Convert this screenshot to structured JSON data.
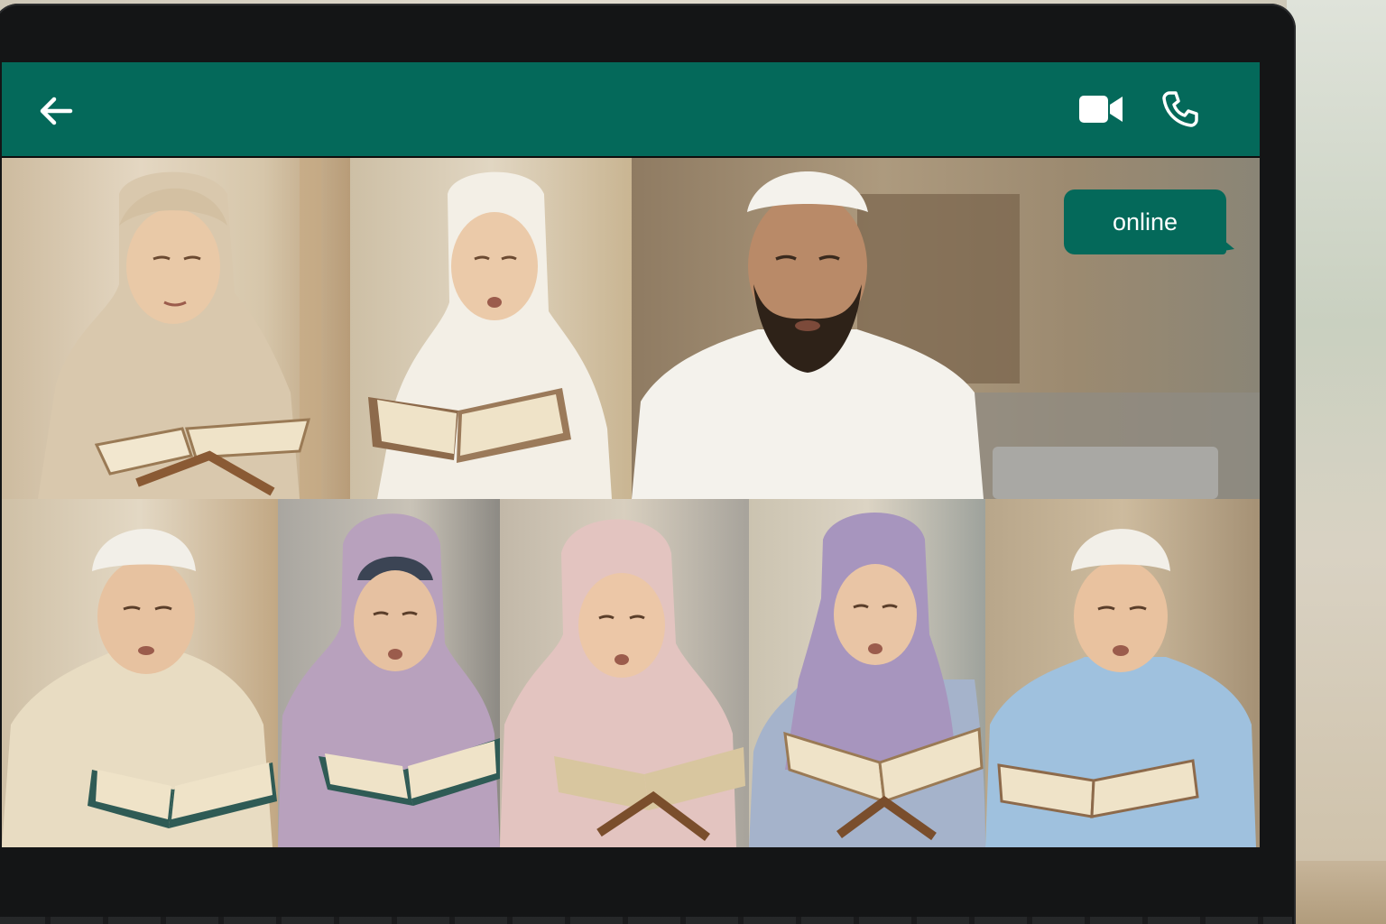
{
  "app": {
    "header": {
      "back_icon": "arrow-left-icon",
      "video_icon": "video-camera-icon",
      "call_icon": "phone-icon",
      "bar_color": "#04695a"
    },
    "status_badge": {
      "label": "online",
      "color": "#04695a"
    },
    "participants": [
      {
        "id": "student-1",
        "role": "student",
        "headwear": "hijab",
        "hijab_color": "#d9c8ad",
        "outfit_color": "#d7c4a6",
        "activity": "reading"
      },
      {
        "id": "student-2",
        "role": "student",
        "headwear": "hijab",
        "hijab_color": "#f3efe6",
        "outfit_color": "#f0ece4",
        "activity": "reading"
      },
      {
        "id": "teacher",
        "role": "teacher",
        "headwear": "kufi",
        "outfit_color": "#f4f2ec",
        "activity": "speaking"
      },
      {
        "id": "student-3",
        "role": "student",
        "headwear": "kufi",
        "outfit_color": "#e8dcc2",
        "activity": "reading"
      },
      {
        "id": "student-4",
        "role": "student",
        "headwear": "hijab",
        "hijab_color": "#b8a1bd",
        "outfit_color": "#b9a5bd",
        "activity": "reading"
      },
      {
        "id": "student-5",
        "role": "student",
        "headwear": "hijab",
        "hijab_color": "#e3c4c0",
        "outfit_color": "#e8cfcb",
        "activity": "reading"
      },
      {
        "id": "student-6",
        "role": "student",
        "headwear": "hijab",
        "hijab_color": "#a795be",
        "outfit_color": "#a5b3cb",
        "activity": "reading"
      },
      {
        "id": "student-7",
        "role": "student",
        "headwear": "kufi",
        "outfit_color": "#9fc1de",
        "activity": "reading"
      }
    ]
  }
}
